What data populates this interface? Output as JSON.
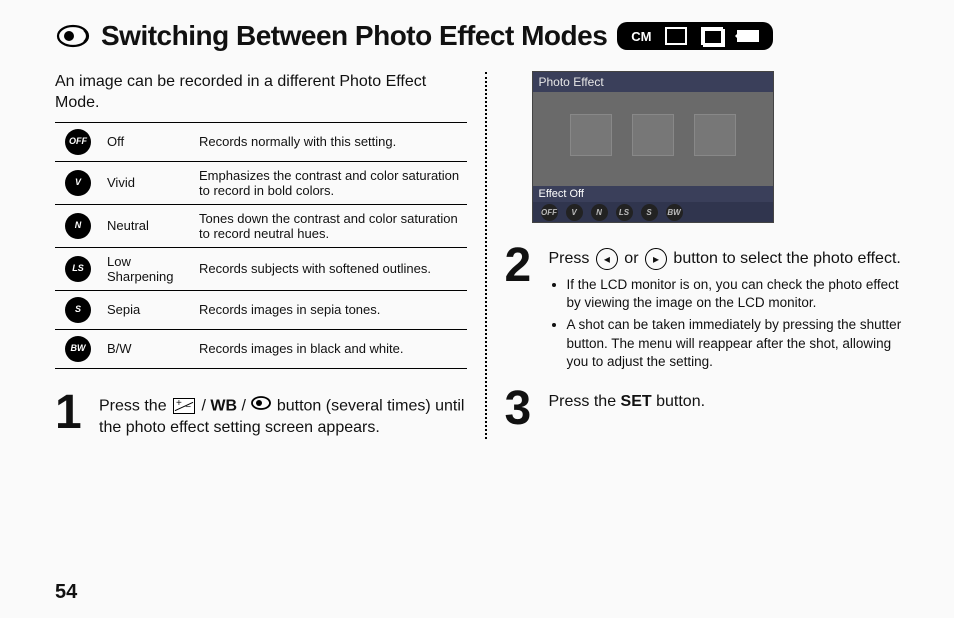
{
  "header": {
    "title": "Switching Between Photo Effect Modes",
    "badge_text": "CM"
  },
  "intro": "An image can be recorded in a different Photo Effect Mode.",
  "effects": [
    {
      "code": "OFF",
      "name": "Off",
      "desc": "Records normally with this setting."
    },
    {
      "code": "V",
      "name": "Vivid",
      "desc": "Emphasizes the contrast and color saturation to record in bold colors."
    },
    {
      "code": "N",
      "name": "Neutral",
      "desc": "Tones down the contrast and color saturation to record neutral hues."
    },
    {
      "code": "LS",
      "name": "Low Sharpening",
      "desc": "Records subjects with softened outlines."
    },
    {
      "code": "S",
      "name": "Sepia",
      "desc": "Records images in sepia tones."
    },
    {
      "code": "BW",
      "name": "B/W",
      "desc": "Records images in black and white."
    }
  ],
  "lcd": {
    "title": "Photo Effect",
    "status": "Effect Off",
    "icons": [
      "OFF",
      "V",
      "N",
      "LS",
      "S",
      "BW"
    ]
  },
  "steps": {
    "s1_prefix": "Press the ",
    "s1_wb": "WB",
    "s1_suffix": " button (several times) until the photo effect setting screen appears.",
    "s2_prefix": "Press ",
    "s2_mid": " or ",
    "s2_suffix": " button to select the photo effect.",
    "s2_bullets": [
      "If the LCD monitor is on, you can check the photo effect by viewing the image on the LCD monitor.",
      "A shot can be taken immediately by pressing the shutter button. The menu will reappear after the shot, allowing you to adjust the setting."
    ],
    "s3_prefix": "Press the ",
    "s3_set": "SET",
    "s3_suffix": " button."
  },
  "page_number": "54"
}
